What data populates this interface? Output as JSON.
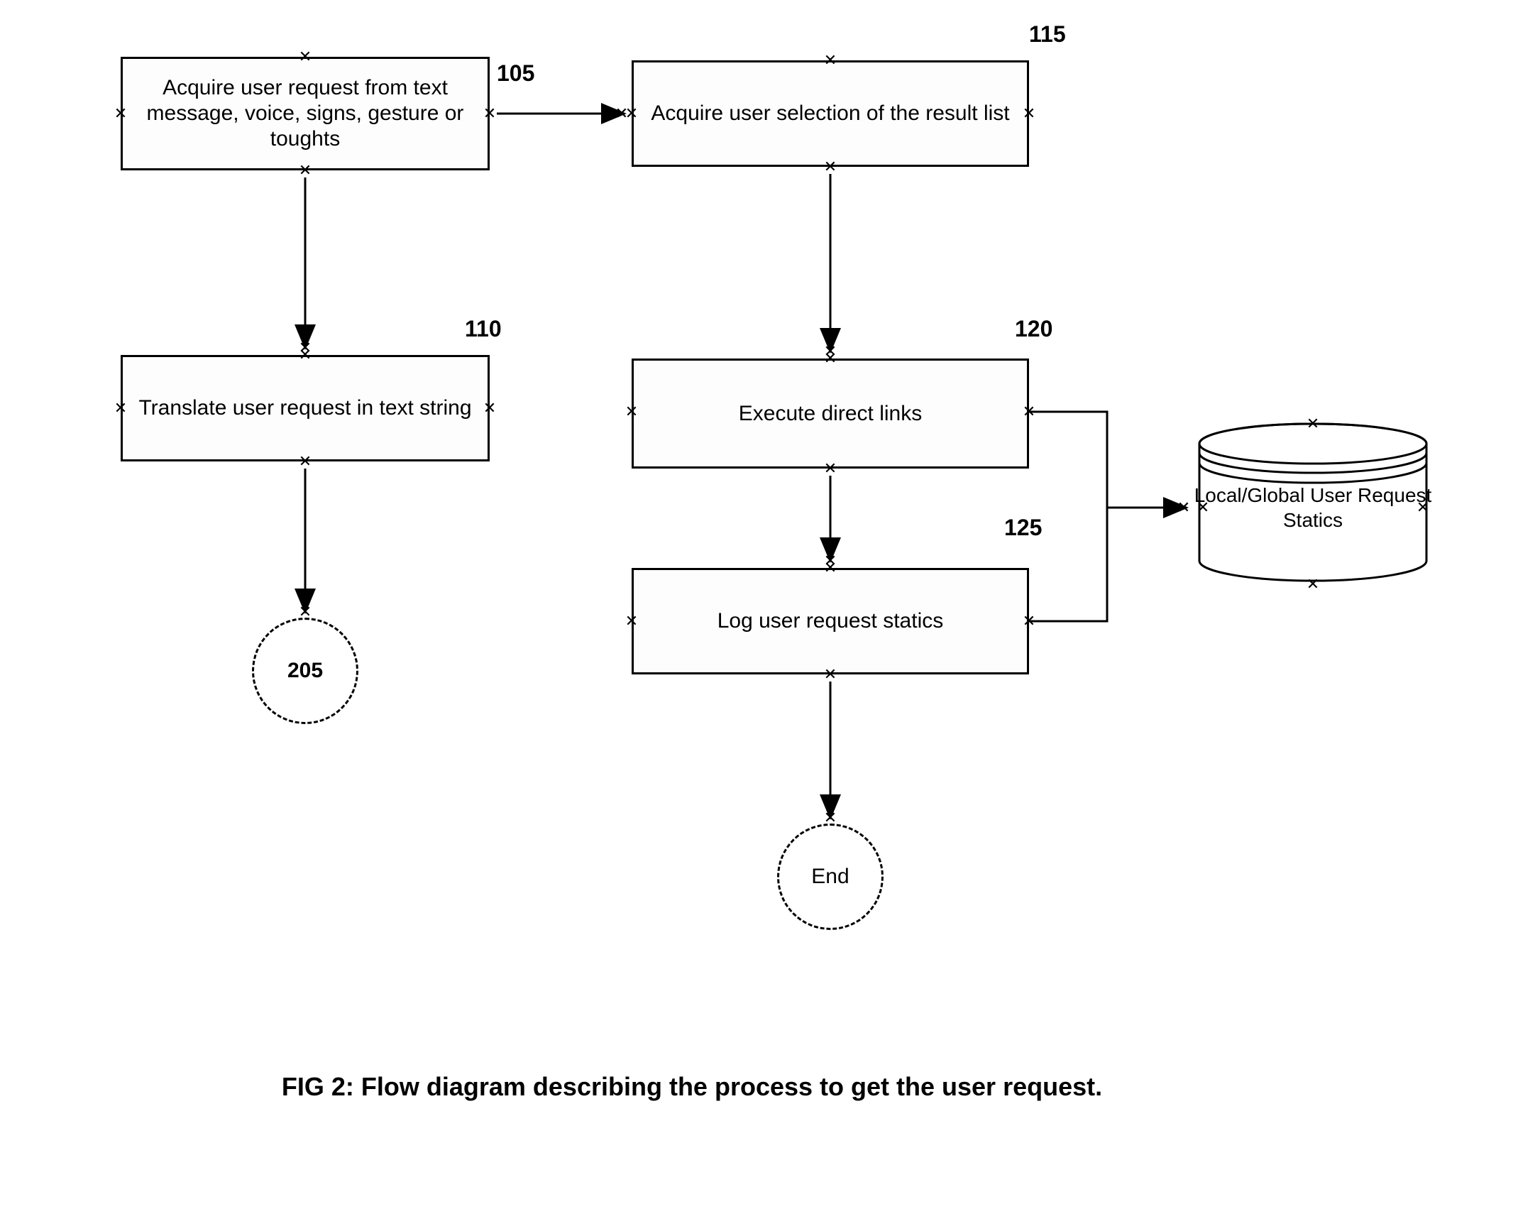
{
  "nodes": {
    "n105": {
      "text": "Acquire user request from text message, voice, signs, gesture or toughts",
      "label": "105"
    },
    "n110": {
      "text": "Translate user request in text string",
      "label": "110"
    },
    "n115": {
      "text": "Acquire user selection of the result list",
      "label": "115"
    },
    "n120": {
      "text": "Execute direct links",
      "label": "120"
    },
    "n125": {
      "text": "Log user request statics",
      "label": "125"
    },
    "c205": {
      "text": "205"
    },
    "cEnd": {
      "text": "End"
    },
    "db": {
      "text": "Local/Global User Request Statics"
    }
  },
  "caption": "FIG 2: Flow diagram describing the process to get the user request."
}
